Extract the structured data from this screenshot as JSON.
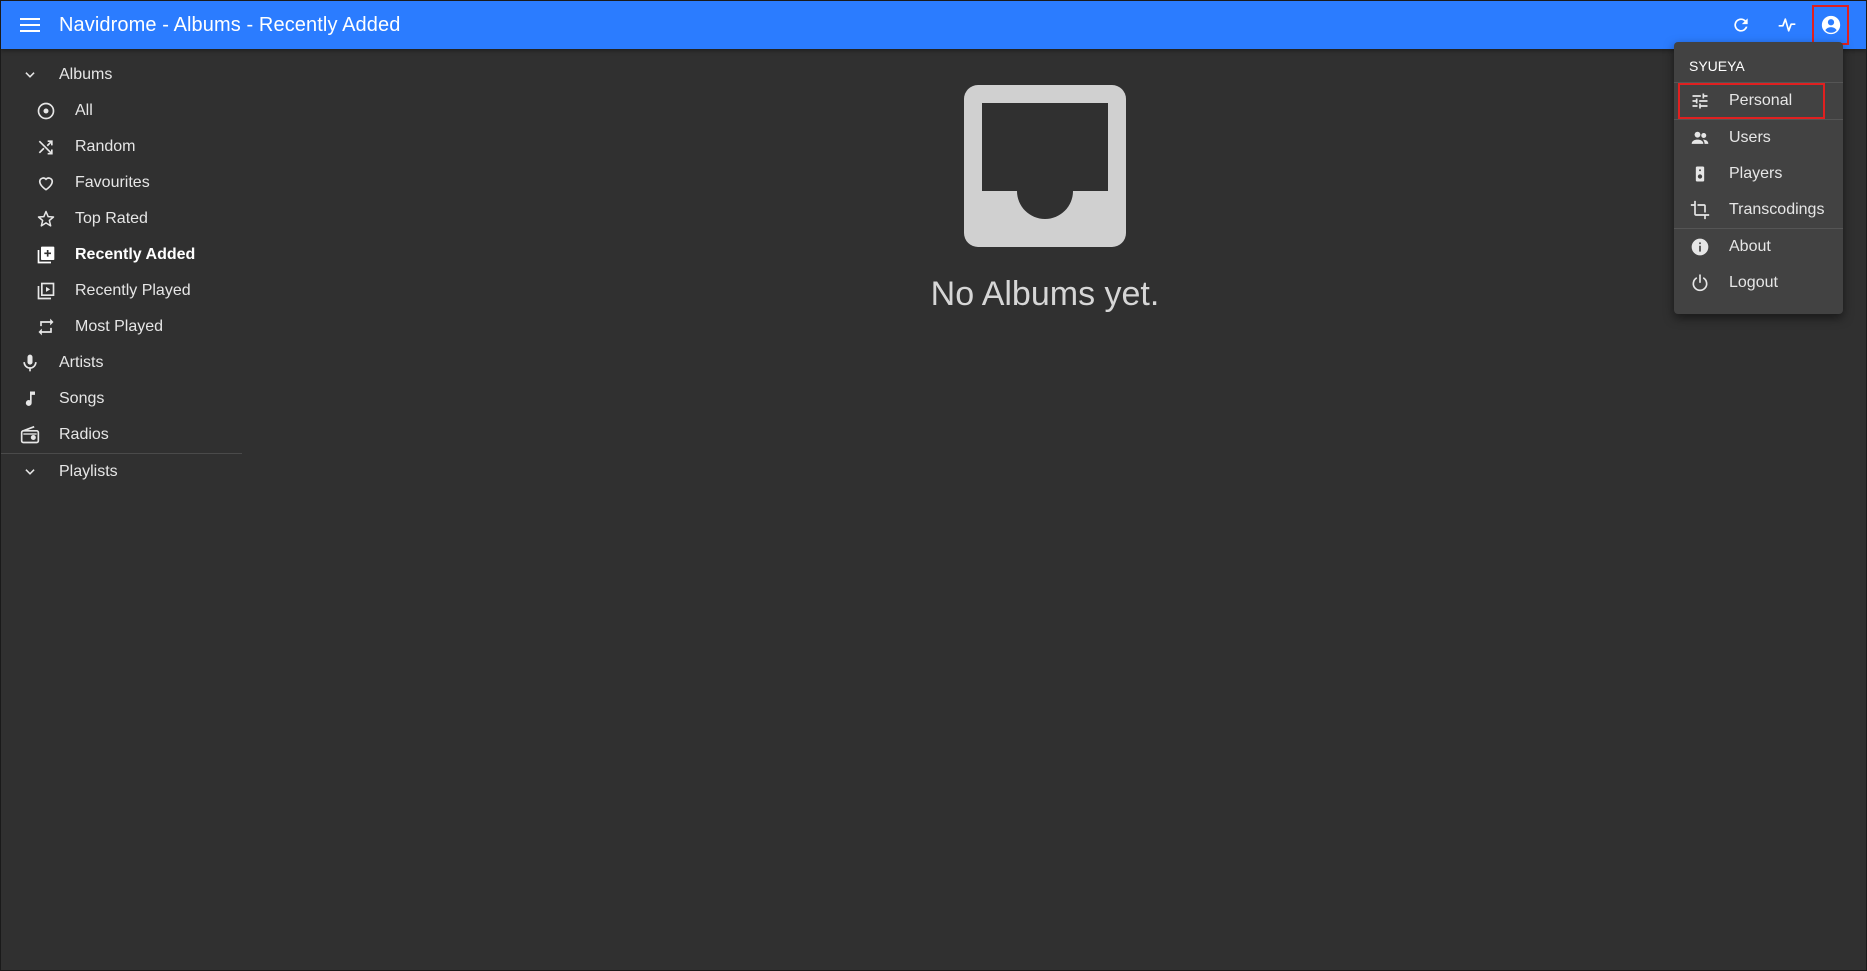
{
  "app": {
    "title": "Navidrome - Albums - Recently Added"
  },
  "appbar": {
    "menu_icon": "menu-icon",
    "actions": [
      {
        "name": "refresh-icon"
      },
      {
        "name": "activity-icon"
      },
      {
        "name": "account-circle-icon"
      }
    ]
  },
  "sidebar": {
    "albums_section": {
      "label": "Albums",
      "icon": "chevron-down-icon"
    },
    "album_items": [
      {
        "label": "All",
        "icon": "album-icon"
      },
      {
        "label": "Random",
        "icon": "shuffle-icon"
      },
      {
        "label": "Favourites",
        "icon": "heart-outline-icon"
      },
      {
        "label": "Top Rated",
        "icon": "star-outline-icon"
      },
      {
        "label": "Recently Added",
        "icon": "library-add-icon",
        "active": true
      },
      {
        "label": "Recently Played",
        "icon": "video-library-icon"
      },
      {
        "label": "Most Played",
        "icon": "repeat-icon"
      }
    ],
    "items": [
      {
        "label": "Artists",
        "icon": "mic-icon"
      },
      {
        "label": "Songs",
        "icon": "music-note-icon"
      },
      {
        "label": "Radios",
        "icon": "radio-icon"
      }
    ],
    "playlists_section": {
      "label": "Playlists",
      "icon": "chevron-down-icon"
    }
  },
  "main": {
    "empty_icon": "inbox-icon",
    "empty_text": "No Albums yet."
  },
  "user_menu": {
    "username": "SYUEYA",
    "items": [
      {
        "label": "Personal",
        "icon": "tune-icon"
      },
      {
        "label": "Users",
        "icon": "people-icon"
      },
      {
        "label": "Players",
        "icon": "speaker-icon"
      },
      {
        "label": "Transcodings",
        "icon": "crop-icon"
      },
      {
        "label": "About",
        "icon": "info-icon"
      },
      {
        "label": "Logout",
        "icon": "power-icon"
      }
    ]
  },
  "colors": {
    "appbar": "#2b7cff",
    "background": "#303030",
    "menu": "#424242",
    "highlight": "#e02020"
  }
}
